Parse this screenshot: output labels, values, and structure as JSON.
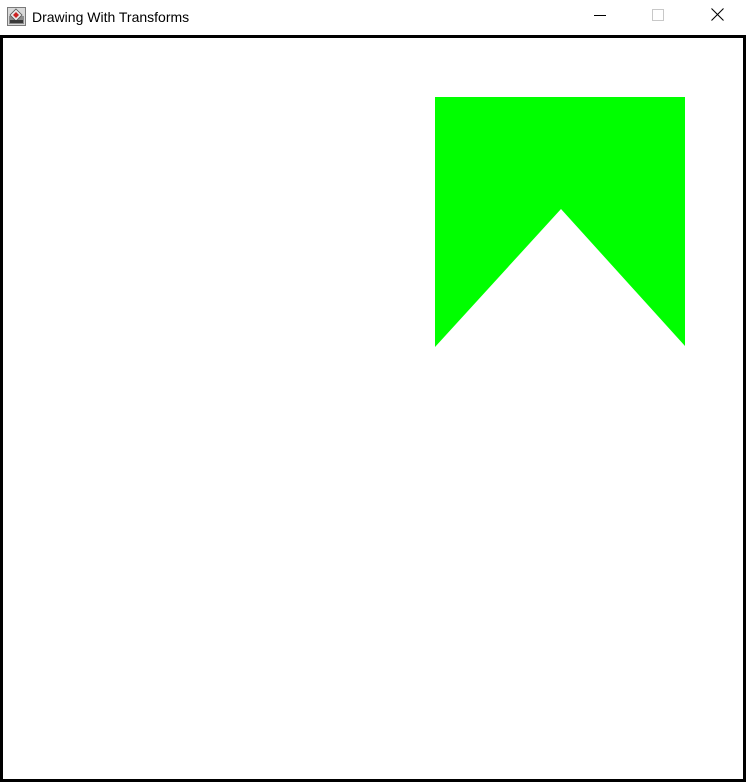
{
  "window": {
    "title": "Drawing With Transforms",
    "icon": "java-cup-icon",
    "controls": {
      "minimize_icon": "minimize-icon",
      "maximize_icon": "maximize-icon",
      "close_icon": "close-icon"
    }
  },
  "canvas": {
    "background": "#ffffff",
    "border_color": "#000000",
    "shape": {
      "kind": "chevron-banner",
      "fill": "#00ff00"
    }
  }
}
